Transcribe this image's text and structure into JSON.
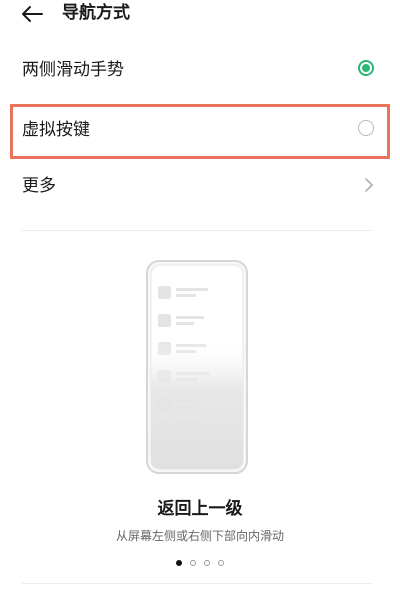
{
  "header": {
    "back_icon": "arrow-left-icon",
    "title": "导航方式"
  },
  "options": [
    {
      "label": "两侧滑动手势",
      "state": "selected"
    },
    {
      "label": "虚拟按键",
      "state": "unselected"
    },
    {
      "label": "更多",
      "icon": "chevron-right-icon"
    }
  ],
  "highlight_color": "#e8735a",
  "accent_color": "#2bb673",
  "gesture": {
    "title": "返回上一级",
    "description": "从屏幕左侧或右侧下部向内滑动"
  },
  "pager": {
    "current": 1,
    "total": 4
  }
}
